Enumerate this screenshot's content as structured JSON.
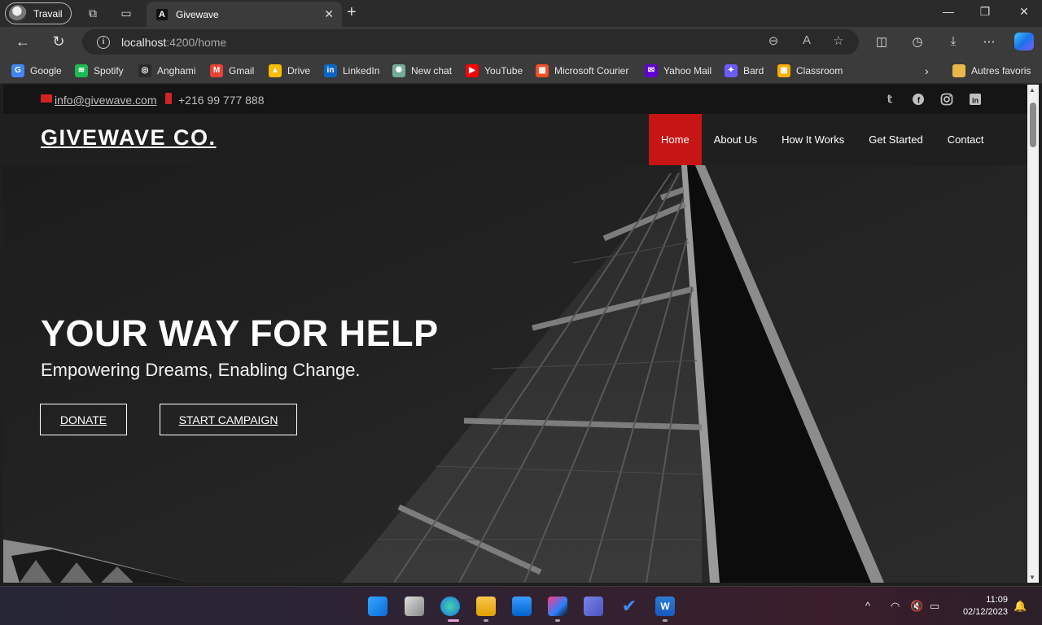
{
  "browser": {
    "profile_label": "Travail",
    "tab_title": "Givewave",
    "tab_logo_letter": "A",
    "url_host": "localhost",
    "url_path": ":4200/home",
    "bookmarks": [
      {
        "label": "Google",
        "icon": "google-icon",
        "color": "#4285f4",
        "glyph": "G"
      },
      {
        "label": "Spotify",
        "icon": "spotify-icon",
        "color": "#1db954",
        "glyph": "≋"
      },
      {
        "label": "Anghami",
        "icon": "anghami-icon",
        "color": "#2a2a2a",
        "glyph": "◎"
      },
      {
        "label": "Gmail",
        "icon": "gmail-icon",
        "color": "#ea4335",
        "glyph": "M"
      },
      {
        "label": "Drive",
        "icon": "drive-icon",
        "color": "#fbbc04",
        "glyph": "▲"
      },
      {
        "label": "LinkedIn",
        "icon": "linkedin-icon",
        "color": "#0a66c2",
        "glyph": "in"
      },
      {
        "label": "New chat",
        "icon": "chatgpt-icon",
        "color": "#74aa9c",
        "glyph": "✺"
      },
      {
        "label": "YouTube",
        "icon": "youtube-icon",
        "color": "#ff0000",
        "glyph": "▶"
      },
      {
        "label": "Microsoft Courier",
        "icon": "microsoft-icon",
        "color": "#f25022",
        "glyph": "▦"
      },
      {
        "label": "Yahoo Mail",
        "icon": "yahoo-mail-icon",
        "color": "#6001d2",
        "glyph": "✉"
      },
      {
        "label": "Bard",
        "icon": "bard-icon",
        "color": "#6b5cff",
        "glyph": "✦"
      },
      {
        "label": "Classroom",
        "icon": "classroom-icon",
        "color": "#f9ab00",
        "glyph": "▣"
      }
    ],
    "other_favorites": "Autres favoris"
  },
  "site": {
    "email": "info@givewave.com",
    "phone": "+216 99 777 888",
    "brand": "GIVEWAVE CO.",
    "menu": [
      {
        "label": "Home",
        "active": true
      },
      {
        "label": "About Us",
        "active": false
      },
      {
        "label": "How It Works",
        "active": false
      },
      {
        "label": "Get Started",
        "active": false
      },
      {
        "label": "Contact",
        "active": false
      }
    ],
    "social": [
      "twitter-icon",
      "facebook-icon",
      "instagram-icon",
      "linkedin-icon"
    ],
    "hero": {
      "title": "YOUR WAY FOR HELP",
      "subtitle": "Empowering Dreams, Enabling Change.",
      "donate": "DONATE",
      "start": "START CAMPAIGN"
    },
    "accent": "#c71414"
  },
  "taskbar": {
    "time": "11:09",
    "date": "02/12/2023"
  }
}
